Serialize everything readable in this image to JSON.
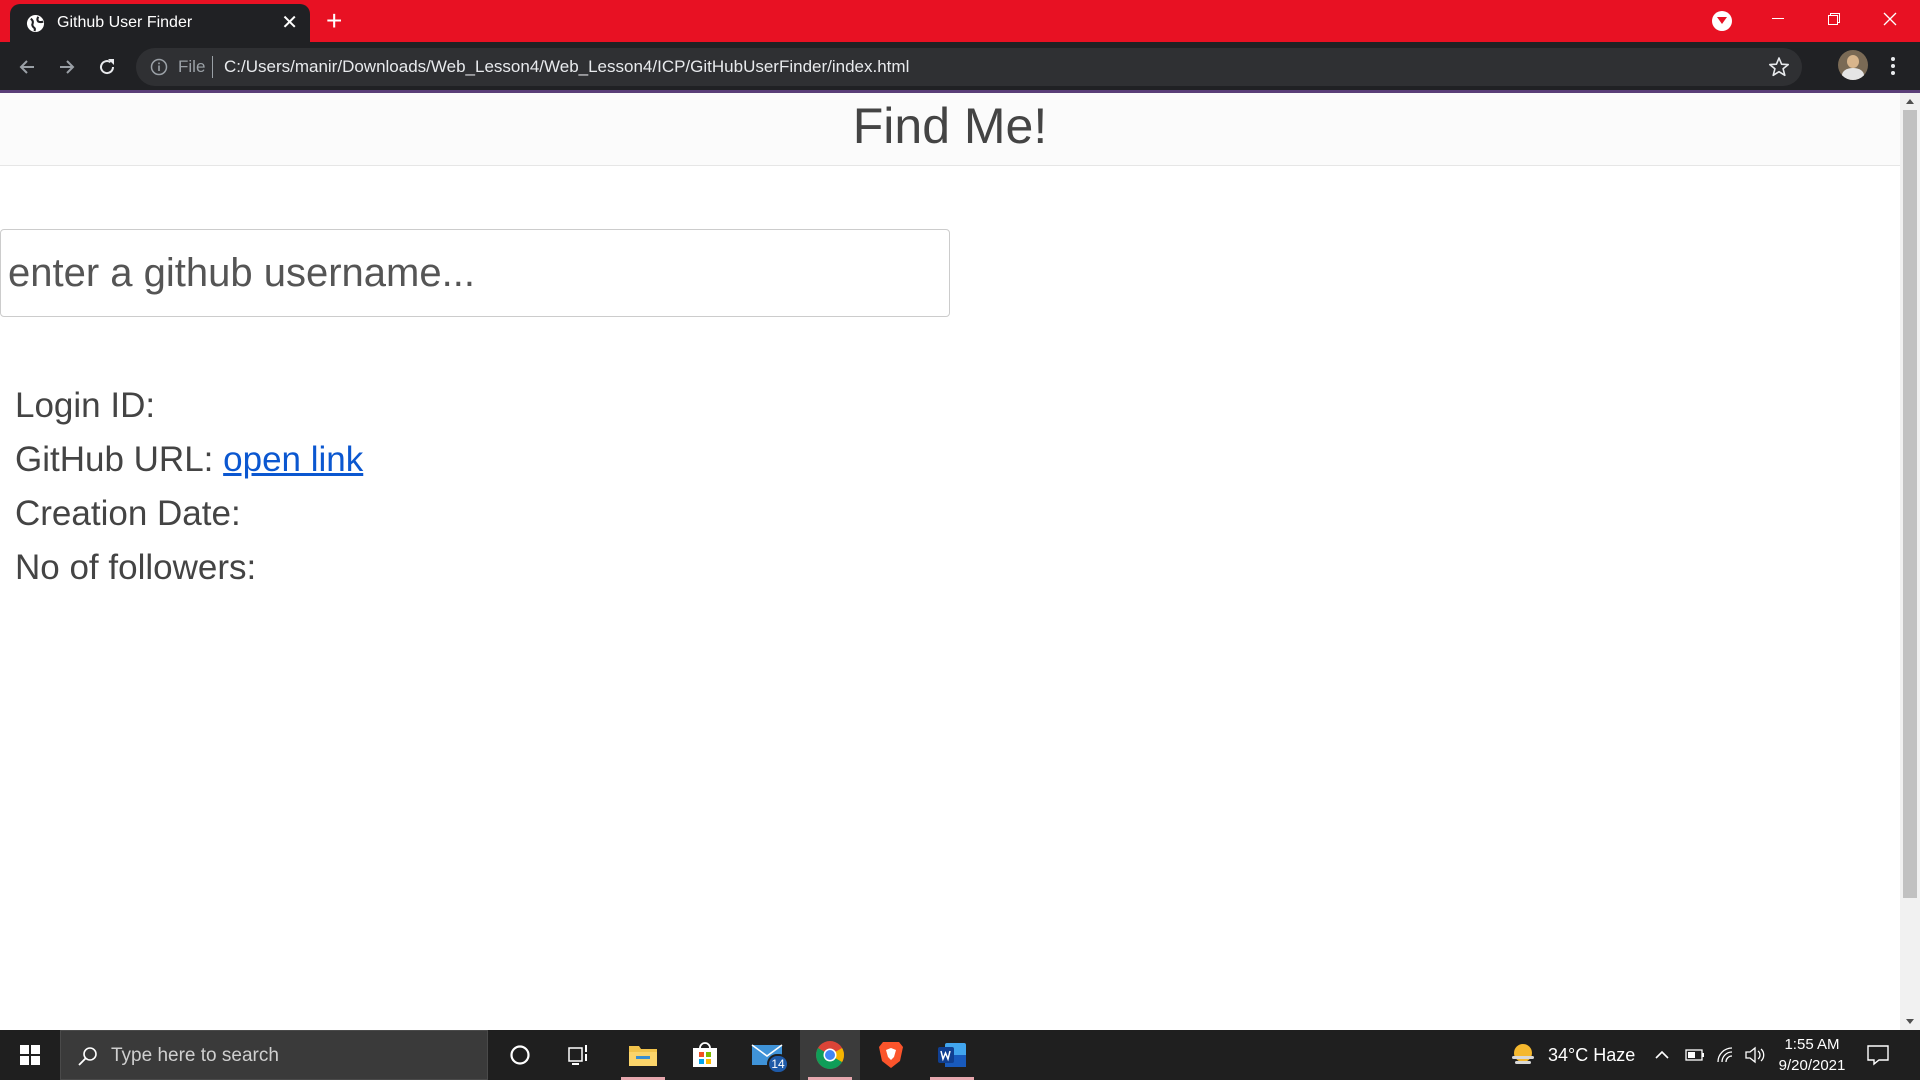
{
  "browser": {
    "tab": {
      "title": "Github User Finder"
    },
    "address": {
      "scheme": "File",
      "url": "C:/Users/manir/Downloads/Web_Lesson4/Web_Lesson4/ICP/GitHubUserFinder/index.html"
    },
    "accent_color": "#e81123"
  },
  "page": {
    "title": "Find Me!",
    "search": {
      "placeholder": "enter a github username...",
      "value": ""
    },
    "fields": {
      "login_label": "Login ID:",
      "url_label": "GitHub URL:",
      "url_link_text": "open link",
      "creation_label": "Creation Date:",
      "followers_label": "No of followers:"
    },
    "link_color": "#0b57d0"
  },
  "taskbar": {
    "search_placeholder": "Type here to search",
    "mail_badge": "14",
    "weather": "34°C  Haze",
    "time": "1:55 AM",
    "date": "9/20/2021",
    "apps": [
      "cortana-icon",
      "task-view-icon",
      "file-explorer-icon",
      "store-icon",
      "mail-icon",
      "chrome-icon",
      "brave-icon",
      "word-icon"
    ]
  }
}
